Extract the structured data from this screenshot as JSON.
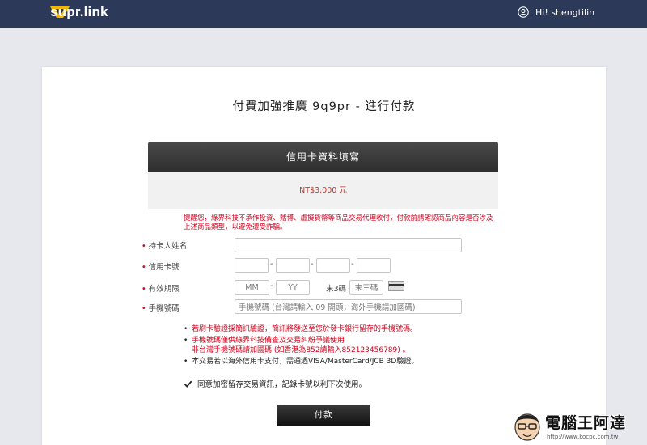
{
  "header": {
    "brand": "supr.link",
    "user_greeting": "Hi! shengtilin"
  },
  "page": {
    "title": "付費加強推廣 9q9pr - 進行付款"
  },
  "card_section": {
    "title": "信用卡資料填寫",
    "amount": "NT$3,000 元",
    "warning": "提醒您，綠界科技不承作投資、賭博、虛擬貨幣等商品交易代理收付，付款前請確認商品內容是否涉及上述商品類型，以避免遭受詐騙。"
  },
  "form": {
    "cardholder": {
      "label": "持卡人姓名",
      "value": ""
    },
    "card_number": {
      "label": "信用卡號",
      "parts": [
        "",
        "",
        "",
        ""
      ],
      "separator": "-"
    },
    "expiry": {
      "label": "有效期限",
      "month_placeholder": "MM",
      "year_placeholder": "YY",
      "separator": "-",
      "cvv_label": "末3碼",
      "cvv_placeholder": "末三碼"
    },
    "phone": {
      "label": "手機號碼",
      "placeholder": "手機號碼 (台灣請輸入 09 開頭，海外手機請加國碼)"
    }
  },
  "notes": {
    "n1": "若刷卡驗證採簡訊驗證，簡訊將發送至您於發卡銀行留存的手機號碼。",
    "n2_line1": "手機號碼僅供綠界科技備查及交易糾紛爭議使用",
    "n2_line2": "非台灣手機號碼請加國碼 (如香港為852請輸入852123456789) 。",
    "n3": "本交易若以海外信用卡支付，需通過VISA/MasterCard/JCB 3D驗證。"
  },
  "remember": {
    "label": "同意加密留存交易資訊，記錄卡號以利下次使用。",
    "checked": true
  },
  "pay_button": {
    "label": "付款"
  },
  "watermark": {
    "brand": "電腦王阿達",
    "url": "http://www.kocpc.com.tw"
  },
  "colors": {
    "header_bg": "#2c3959",
    "accent_red": "#d0021b",
    "button_bg": "#1a1a1a",
    "logo_gold": "#f2b705"
  }
}
